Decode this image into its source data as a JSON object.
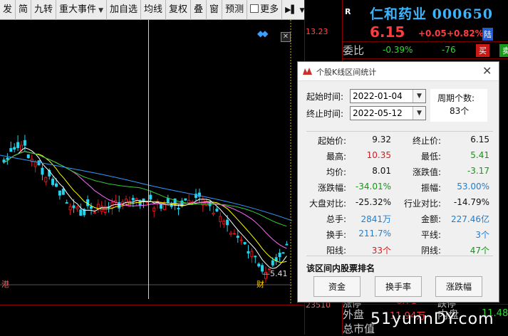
{
  "toolbar": {
    "items": [
      "发",
      "简",
      "九转",
      "重大事件",
      "加自选",
      "均线",
      "复权",
      "叠",
      "窗",
      "预测",
      "更多"
    ]
  },
  "axis": {
    "price_label": "13.23",
    "bottom_label": "23510"
  },
  "chart": {
    "low_marker": "5.41",
    "left_bottom_text": "港",
    "bottom_text": "财"
  },
  "quote": {
    "market_tag": "R",
    "name": "仁和药业 000650",
    "price": "6.15",
    "change": "+0.05",
    "change_pct": "+0.82%",
    "board_tag": "陆",
    "webi_label": "委比",
    "webi_pct": "-0.39%",
    "webi_diff": "-76",
    "buy_label": "买",
    "sell_label": "卖",
    "bottom_rows": [
      {
        "label": "涨停",
        "value": "6.71",
        "label2": "跌停"
      },
      {
        "label": "外盘",
        "value": "11.94万",
        "label2": "内盘",
        "value2": "11.48"
      },
      {
        "label": "总市值",
        "value": "",
        "label2": "",
        "value2": ""
      }
    ]
  },
  "dialog": {
    "title": "个股K线区间统计",
    "start_label": "起始时间:",
    "start_value": "2022-01-04",
    "end_label": "终止时间:",
    "end_value": "2022-05-12",
    "period_label": "周期个数:",
    "period_value": "83个",
    "stats": [
      {
        "l1": "起始价:",
        "v1": "9.32",
        "c1": "black",
        "l2": "终止价:",
        "v2": "6.15",
        "c2": "black"
      },
      {
        "l1": "最高:",
        "v1": "10.35",
        "c1": "red",
        "l2": "最低:",
        "v2": "5.41",
        "c2": "green"
      },
      {
        "l1": "均价:",
        "v1": "8.01",
        "c1": "black",
        "l2": "涨跌值:",
        "v2": "-3.17",
        "c2": "green"
      },
      {
        "l1": "涨跌幅:",
        "v1": "-34.01%",
        "c1": "green",
        "l2": "振幅:",
        "v2": "53.00%",
        "c2": "blue"
      },
      {
        "l1": "大盘对比:",
        "v1": "-25.32%",
        "c1": "black",
        "l2": "行业对比:",
        "v2": "-14.79%",
        "c2": "black"
      },
      {
        "l1": "总手:",
        "v1": "2841万",
        "c1": "blue",
        "l2": "金额:",
        "v2": "227.46亿",
        "c2": "blue"
      },
      {
        "l1": "换手:",
        "v1": "211.7%",
        "c1": "blue",
        "l2": "平线:",
        "v2": "3个",
        "c2": "blue"
      },
      {
        "l1": "阳线:",
        "v1": "33个",
        "c1": "red",
        "l2": "阴线:",
        "v2": "47个",
        "c2": "green"
      }
    ],
    "rank_label": "该区间内股票排名",
    "buttons": [
      "资金",
      "换手率",
      "涨跌幅"
    ]
  },
  "watermark": "51yunnDY.com",
  "colors": {
    "up": "#e0141a",
    "down": "#0f9a0f",
    "ma5": "#ffffff",
    "ma10": "#ffff00",
    "ma20": "#ff66ff",
    "ma60": "#33cc33",
    "ma120": "#3399ff"
  }
}
